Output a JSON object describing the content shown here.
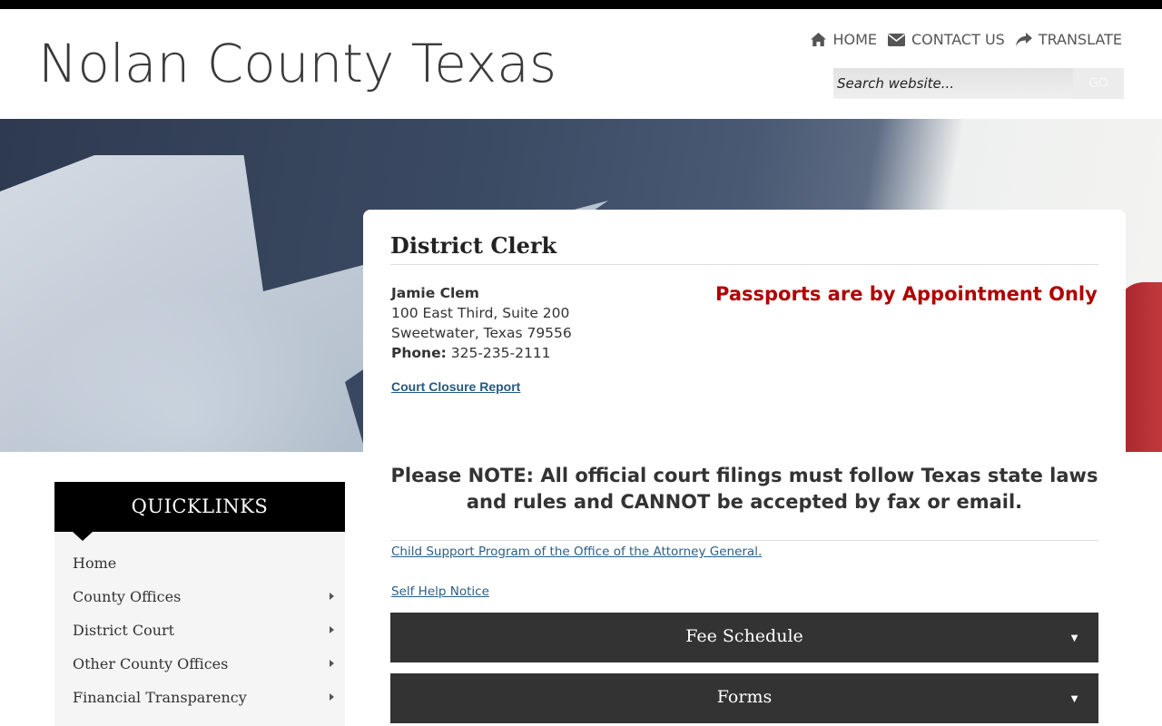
{
  "site": {
    "title": "Nolan County Texas"
  },
  "topnav": [
    {
      "label": "HOME",
      "icon": "home-icon"
    },
    {
      "label": "CONTACT US",
      "icon": "envelope-icon"
    },
    {
      "label": "TRANSLATE",
      "icon": "share-arrow-icon"
    }
  ],
  "search": {
    "placeholder": "Search website...",
    "button": "GO"
  },
  "page": {
    "title": "District Clerk",
    "contact": {
      "name": "Jamie Clem",
      "address1": "100 East Third, Suite 200",
      "address2": "Sweetwater, Texas 79556",
      "phone_label": "Phone:",
      "phone": "325-235-2111"
    },
    "closure_link": "Court Closure Report",
    "passport_notice": "Passports are by Appointment Only",
    "filing_notice": "Please NOTE: All official court filings must follow Texas state laws and rules and CANNOT be accepted by fax or email.",
    "links": [
      "Child Support Program of the Office of the Attorney General.",
      "Self Help Notice"
    ],
    "accordions": [
      {
        "label": "Fee Schedule"
      },
      {
        "label": "Forms"
      }
    ]
  },
  "quicklinks": {
    "title": "QUICKLINKS",
    "items": [
      {
        "label": "Home",
        "has_submenu": false
      },
      {
        "label": "County Offices",
        "has_submenu": true
      },
      {
        "label": "District Court",
        "has_submenu": true
      },
      {
        "label": "Other County Offices",
        "has_submenu": true
      },
      {
        "label": "Financial Transparency",
        "has_submenu": true
      }
    ]
  },
  "colors": {
    "notice_red": "#b00000",
    "link_blue": "#2b5f85",
    "accordion_bg": "#333333"
  }
}
